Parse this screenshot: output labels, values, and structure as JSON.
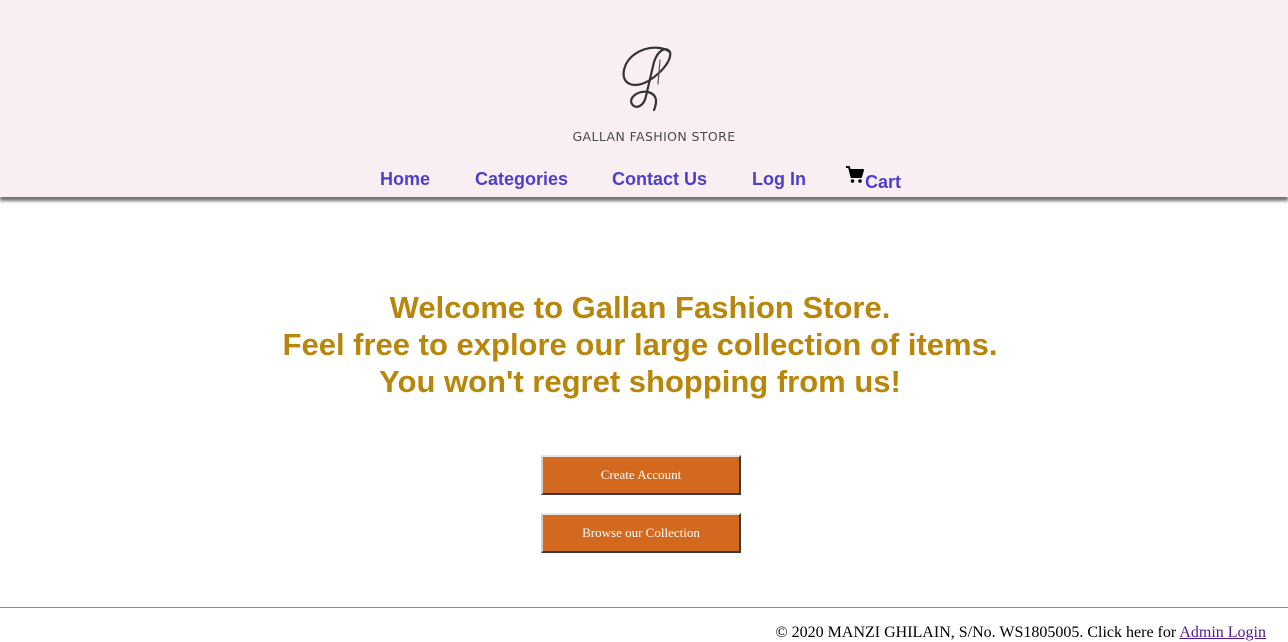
{
  "header": {
    "logo_text": "GALLAN FASHION STORE",
    "logo_icon": "script-g-logo"
  },
  "nav": {
    "items": [
      {
        "label": "Home"
      },
      {
        "label": "Categories"
      },
      {
        "label": "Contact Us"
      },
      {
        "label": "Log In"
      },
      {
        "label": "Cart",
        "icon": "cart-icon"
      }
    ]
  },
  "welcome": {
    "line1": "Welcome to Gallan Fashion Store.",
    "line2": "Feel free to explore our large collection of items.",
    "line3": "You won't regret shopping from us!"
  },
  "buttons": {
    "create_account": "Create Account",
    "browse_collection": "Browse our Collection"
  },
  "footer": {
    "text": "© 2020 MANZI GHILAIN, S/No. WS1805005. Click here for ",
    "admin_link": "Admin Login"
  },
  "colors": {
    "header_bg": "#f9eff3",
    "nav_link": "#4d3fcc",
    "welcome_text": "#b8860b",
    "button_bg": "#d2691e"
  }
}
